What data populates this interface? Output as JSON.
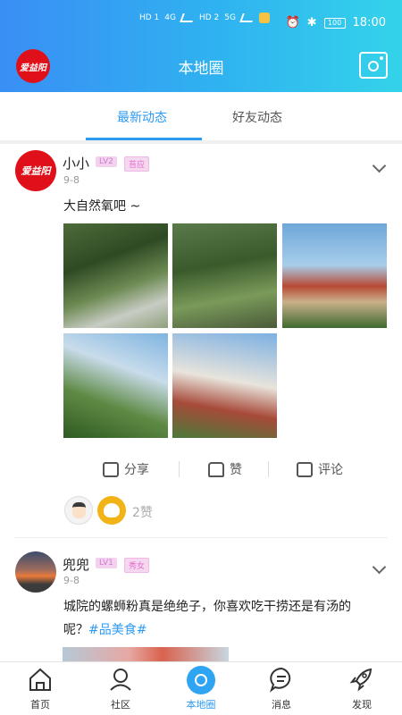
{
  "status_bar": {
    "left_labels": [
      "HD 1",
      "4G",
      "HD 2",
      "5G"
    ],
    "battery": "100",
    "time": "18:00"
  },
  "header": {
    "logo_text": "爱益阳",
    "title": "本地圈",
    "camera_icon": "camera-icon"
  },
  "tabs": [
    {
      "label": "最新动态",
      "active": true
    },
    {
      "label": "好友动态",
      "active": false
    }
  ],
  "posts": [
    {
      "avatar_text": "爱益阳",
      "username": "小小",
      "level": "LV2",
      "tag": "苔应",
      "date": "9-8",
      "text": "大自然氧吧 ~",
      "photos": [
        "forest-photo",
        "trees-photo",
        "pagoda-photo",
        "sky-trees-photo",
        "tower-photo"
      ],
      "actions": {
        "share": "分享",
        "like": "赞",
        "comment": "评论"
      },
      "likes_count": "2赞"
    },
    {
      "username": "兜兜",
      "level": "LV1",
      "tag": "秀女",
      "date": "9-8",
      "text_line1": "城院的螺蛳粉真是绝绝子，你喜欢吃干捞还是有汤的",
      "text_line2": "呢？",
      "hashtag": "#品美食#"
    }
  ],
  "bottom_nav": [
    {
      "label": "首页",
      "icon": "home-icon"
    },
    {
      "label": "社区",
      "icon": "community-icon"
    },
    {
      "label": "本地圈",
      "icon": "local-circle-icon",
      "active": true
    },
    {
      "label": "消息",
      "icon": "message-icon"
    },
    {
      "label": "发现",
      "icon": "rocket-icon"
    }
  ],
  "colors": {
    "accent": "#2e9bf2",
    "brand_red": "#e0101a",
    "header_gradient_start": "#3a8ef5",
    "header_gradient_end": "#34d3ea"
  }
}
